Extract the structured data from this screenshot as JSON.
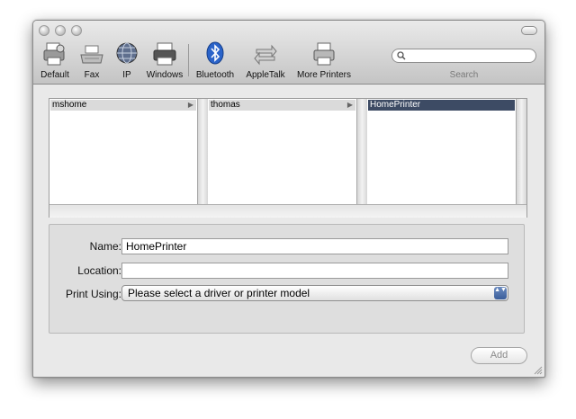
{
  "toolbar": {
    "items": [
      {
        "label": "Default",
        "icon": "default-printer-icon"
      },
      {
        "label": "Fax",
        "icon": "fax-icon"
      },
      {
        "label": "IP",
        "icon": "ip-globe-icon"
      },
      {
        "label": "Windows",
        "icon": "windows-printer-icon"
      },
      {
        "label": "Bluetooth",
        "icon": "bluetooth-icon"
      },
      {
        "label": "AppleTalk",
        "icon": "appletalk-icon"
      },
      {
        "label": "More Printers",
        "icon": "more-printers-icon"
      }
    ],
    "search_placeholder": "",
    "search_label": "Search"
  },
  "browser": {
    "columns": [
      {
        "item": "mshome",
        "has_children": true,
        "selected": false
      },
      {
        "item": "thomas",
        "has_children": true,
        "selected": false
      },
      {
        "item": "HomePrinter",
        "has_children": false,
        "selected": true
      }
    ],
    "selection_color": "#3d4b64"
  },
  "form": {
    "name_label": "Name:",
    "name_value": "HomePrinter",
    "location_label": "Location:",
    "location_value": "",
    "print_using_label": "Print Using:",
    "print_using_value": "Please select a driver or printer model",
    "popup_arrows": "▲▼"
  },
  "buttons": {
    "add_label": "Add"
  },
  "accent": "#3a5d9a"
}
